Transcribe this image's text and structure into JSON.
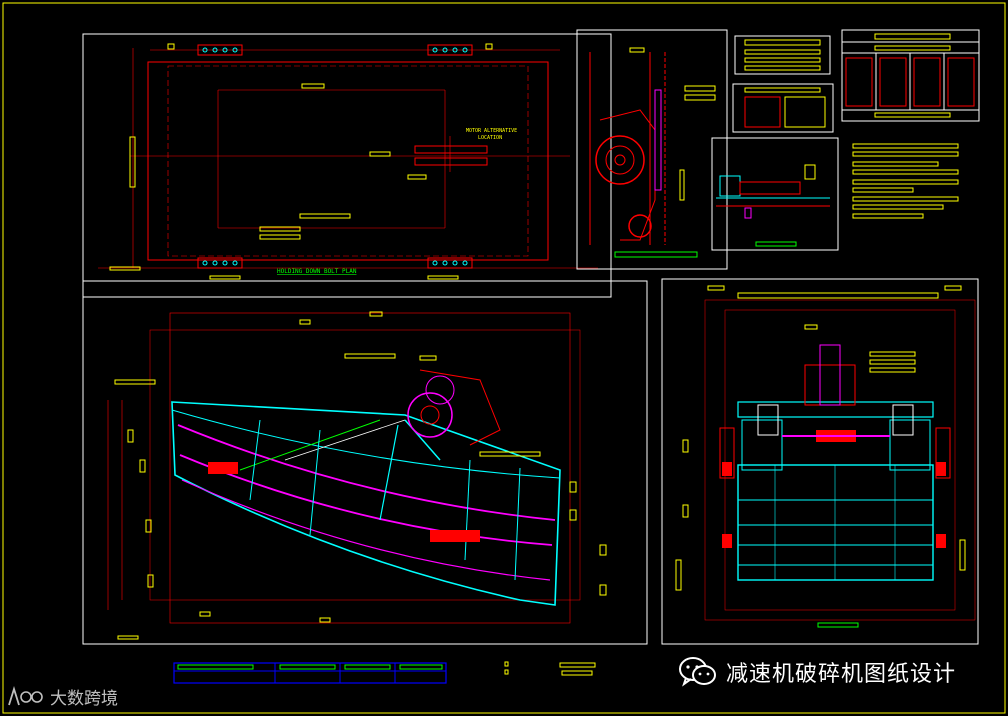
{
  "drawing": {
    "plan_title": "HOLDING DOWN BOLT PLAN",
    "motor_note_line1": "MOTOR ALTERNATIVE",
    "motor_note_line2": "LOCATION"
  },
  "watermark": {
    "text": "减速机破碎机图纸设计",
    "icon": "wechat-icon"
  },
  "corner_logo": {
    "text": "大数跨境",
    "icon": "dashu-logo-icon"
  },
  "colors": {
    "background": "#000000",
    "outline": "#ffffff",
    "red": "#ff0000",
    "yellow": "#ffff00",
    "cyan": "#00ffff",
    "magenta": "#ff00ff",
    "green": "#00ff00",
    "blue": "#0000ff"
  }
}
